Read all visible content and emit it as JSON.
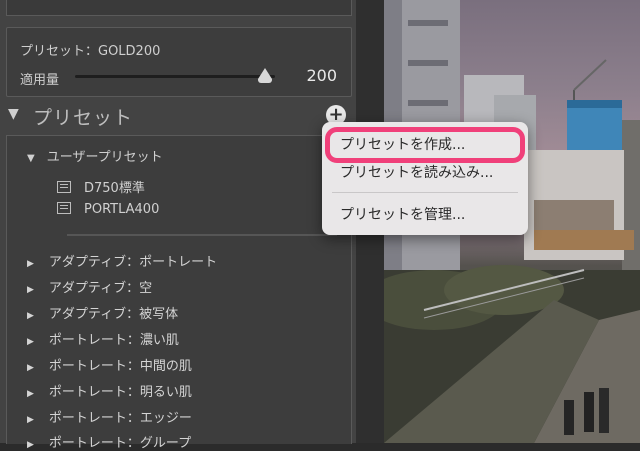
{
  "preset_panel": {
    "current_preset": "プリセット：GOLD200",
    "amount_label": "適用量",
    "amount_value": "200",
    "amount_fraction": 0.95
  },
  "section": {
    "title": "プリセット",
    "add_button": "+"
  },
  "user_group": {
    "label": "ユーザープリセット",
    "items": [
      "D750標準",
      "PORTLA400"
    ]
  },
  "presets": [
    "アダプティブ：ポートレート",
    "アダプティブ：空",
    "アダプティブ：被写体",
    "ポートレート：濃い肌",
    "ポートレート：中間の肌",
    "ポートレート：明るい肌",
    "ポートレート：エッジー",
    "ポートレート：グループ"
  ],
  "menu": {
    "create": "プリセットを作成...",
    "import": "プリセットを読み込み...",
    "manage": "プリセットを管理..."
  },
  "colors": {
    "highlight": "#f0407a",
    "panel_bg": "#434343"
  }
}
